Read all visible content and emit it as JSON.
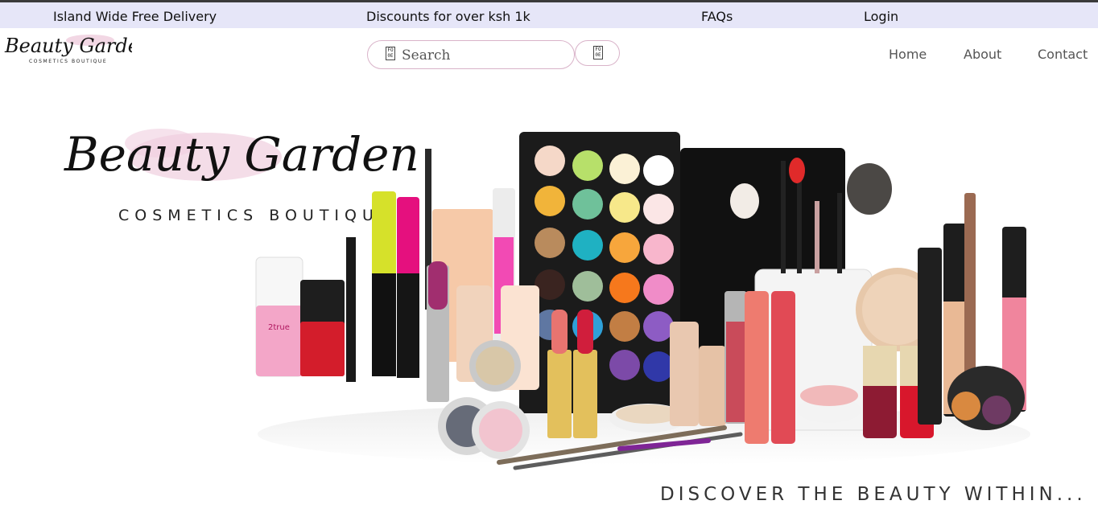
{
  "topbar": {
    "delivery": "Island Wide Free Delivery",
    "discount": "Discounts for over ksh 1k",
    "faqs": "FAQs",
    "login": "Login"
  },
  "header": {
    "logo_script": "Beauty Garden",
    "logo_tagline": "COSMETICS BOUTIQUE",
    "search_placeholder": "Search",
    "nav": [
      "Home",
      "About",
      "Contact"
    ]
  },
  "hero": {
    "brand_script": "Beauty Garden",
    "brand_tagline": "COSMETICS BOUTIQUE",
    "product_label": "2true",
    "slogan": "DISCOVER THE BEAUTY WITHIN..."
  },
  "colors": {
    "topbar_bg": "#e6e6f8",
    "accent_pink": "#e8b6cf",
    "nav_text": "#555555"
  }
}
